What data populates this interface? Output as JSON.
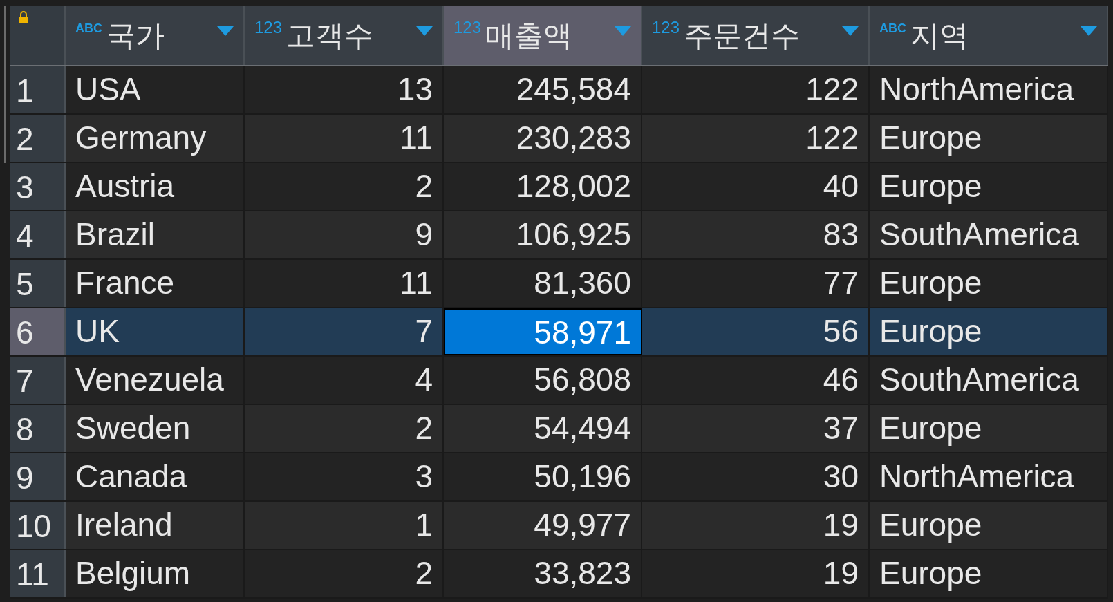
{
  "columns": [
    {
      "type_label": "ABC",
      "label": "국가",
      "kind": "text",
      "selected": false
    },
    {
      "type_label": "123",
      "label": "고객수",
      "kind": "number",
      "selected": false
    },
    {
      "type_label": "123",
      "label": "매출액",
      "kind": "number",
      "selected": true
    },
    {
      "type_label": "123",
      "label": "주문건수",
      "kind": "number",
      "selected": false
    },
    {
      "type_label": "ABC",
      "label": "지역",
      "kind": "text",
      "selected": false
    }
  ],
  "rows": [
    {
      "number": "1",
      "selected": false,
      "cells": [
        {
          "text": "USA",
          "selected": false
        },
        {
          "text": "13",
          "selected": false
        },
        {
          "text": "245,584",
          "selected": false
        },
        {
          "text": "122",
          "selected": false
        },
        {
          "text": "NorthAmerica",
          "selected": false
        }
      ]
    },
    {
      "number": "2",
      "selected": false,
      "cells": [
        {
          "text": "Germany",
          "selected": false
        },
        {
          "text": "11",
          "selected": false
        },
        {
          "text": "230,283",
          "selected": false
        },
        {
          "text": "122",
          "selected": false
        },
        {
          "text": "Europe",
          "selected": false
        }
      ]
    },
    {
      "number": "3",
      "selected": false,
      "cells": [
        {
          "text": "Austria",
          "selected": false
        },
        {
          "text": "2",
          "selected": false
        },
        {
          "text": "128,002",
          "selected": false
        },
        {
          "text": "40",
          "selected": false
        },
        {
          "text": "Europe",
          "selected": false
        }
      ]
    },
    {
      "number": "4",
      "selected": false,
      "cells": [
        {
          "text": "Brazil",
          "selected": false
        },
        {
          "text": "9",
          "selected": false
        },
        {
          "text": "106,925",
          "selected": false
        },
        {
          "text": "83",
          "selected": false
        },
        {
          "text": "SouthAmerica",
          "selected": false
        }
      ]
    },
    {
      "number": "5",
      "selected": false,
      "cells": [
        {
          "text": "France",
          "selected": false
        },
        {
          "text": "11",
          "selected": false
        },
        {
          "text": "81,360",
          "selected": false
        },
        {
          "text": "77",
          "selected": false
        },
        {
          "text": "Europe",
          "selected": false
        }
      ]
    },
    {
      "number": "6",
      "selected": true,
      "cells": [
        {
          "text": "UK",
          "selected": false
        },
        {
          "text": "7",
          "selected": false
        },
        {
          "text": "58,971",
          "selected": true
        },
        {
          "text": "56",
          "selected": false
        },
        {
          "text": "Europe",
          "selected": false
        }
      ]
    },
    {
      "number": "7",
      "selected": false,
      "cells": [
        {
          "text": "Venezuela",
          "selected": false
        },
        {
          "text": "4",
          "selected": false
        },
        {
          "text": "56,808",
          "selected": false
        },
        {
          "text": "46",
          "selected": false
        },
        {
          "text": "SouthAmerica",
          "selected": false
        }
      ]
    },
    {
      "number": "8",
      "selected": false,
      "cells": [
        {
          "text": "Sweden",
          "selected": false
        },
        {
          "text": "2",
          "selected": false
        },
        {
          "text": "54,494",
          "selected": false
        },
        {
          "text": "37",
          "selected": false
        },
        {
          "text": "Europe",
          "selected": false
        }
      ]
    },
    {
      "number": "9",
      "selected": false,
      "cells": [
        {
          "text": "Canada",
          "selected": false
        },
        {
          "text": "3",
          "selected": false
        },
        {
          "text": "50,196",
          "selected": false
        },
        {
          "text": "30",
          "selected": false
        },
        {
          "text": "NorthAmerica",
          "selected": false
        }
      ]
    },
    {
      "number": "10",
      "selected": false,
      "cells": [
        {
          "text": "Ireland",
          "selected": false
        },
        {
          "text": "1",
          "selected": false
        },
        {
          "text": "49,977",
          "selected": false
        },
        {
          "text": "19",
          "selected": false
        },
        {
          "text": "Europe",
          "selected": false
        }
      ]
    },
    {
      "number": "11",
      "selected": false,
      "cells": [
        {
          "text": "Belgium",
          "selected": false
        },
        {
          "text": "2",
          "selected": false
        },
        {
          "text": "33,823",
          "selected": false
        },
        {
          "text": "19",
          "selected": false
        },
        {
          "text": "Europe",
          "selected": false
        }
      ]
    }
  ]
}
